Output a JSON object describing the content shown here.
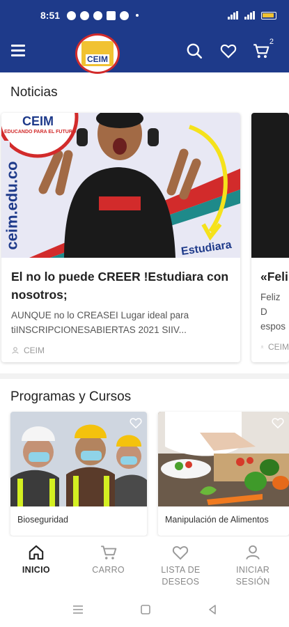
{
  "status_bar": {
    "time": "8:51"
  },
  "app_bar": {
    "logo_text": "CEIM",
    "cart_count": "2"
  },
  "news": {
    "title": "Noticias",
    "cards": [
      {
        "title": "El no lo puede CREER !Estudiara con nosotros;",
        "excerpt": "AUNQUE no lo CREASEI Lugar ideal para tiINSCRIPCIONESABIERTAS 2021 SIIV...",
        "author": "CEIM",
        "image_text_1": "ceim.edu.co",
        "image_text_2": "CEIM",
        "image_text_3": "Estudiara",
        "image_text_4": "EDUCANDO PARA EL FUTURO"
      },
      {
        "title": "«Feli",
        "excerpt": "Feliz D espos",
        "author": "CEIM"
      }
    ]
  },
  "programs": {
    "title": "Programas y Cursos",
    "items": [
      {
        "name": "Bioseguridad"
      },
      {
        "name": "Manipulación de Alimentos"
      }
    ]
  },
  "bottom_nav": {
    "items": [
      {
        "label": "INICIO"
      },
      {
        "label": "CARRO"
      },
      {
        "label": "LISTA DE DESEOS"
      },
      {
        "label": "INICIAR SESIÓN"
      }
    ]
  },
  "colors": {
    "primary": "#1e3a8a",
    "accent": "#d22b2b",
    "yellow": "#f1c232"
  }
}
